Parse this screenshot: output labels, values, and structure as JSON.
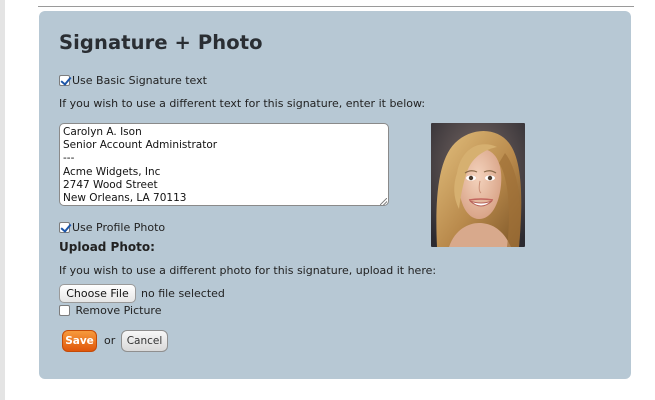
{
  "section": {
    "title": "Signature + Photo"
  },
  "signature": {
    "use_basic_label": "Use Basic Signature text",
    "use_basic_checked": true,
    "instructions": "If you wish to use a different text for this signature, enter it below:",
    "text": "Carolyn A. Ison\nSenior Account Administrator\n---\nAcme Widgets, Inc\n2747 Wood Street\nNew Orleans, LA 70113"
  },
  "photo": {
    "use_profile_label": "Use Profile Photo",
    "use_profile_checked": true,
    "upload_heading": "Upload Photo:",
    "upload_instructions": "If you wish to use a different photo for this signature, upload it here:",
    "choose_file_label": "Choose File",
    "file_status": "no file selected",
    "remove_label": "Remove Picture",
    "remove_checked": false
  },
  "actions": {
    "save_label": "Save",
    "or_text": "or",
    "cancel_label": "Cancel"
  },
  "colors": {
    "panel_bg": "#b7c8d4",
    "save_orange": "#e8670f"
  }
}
